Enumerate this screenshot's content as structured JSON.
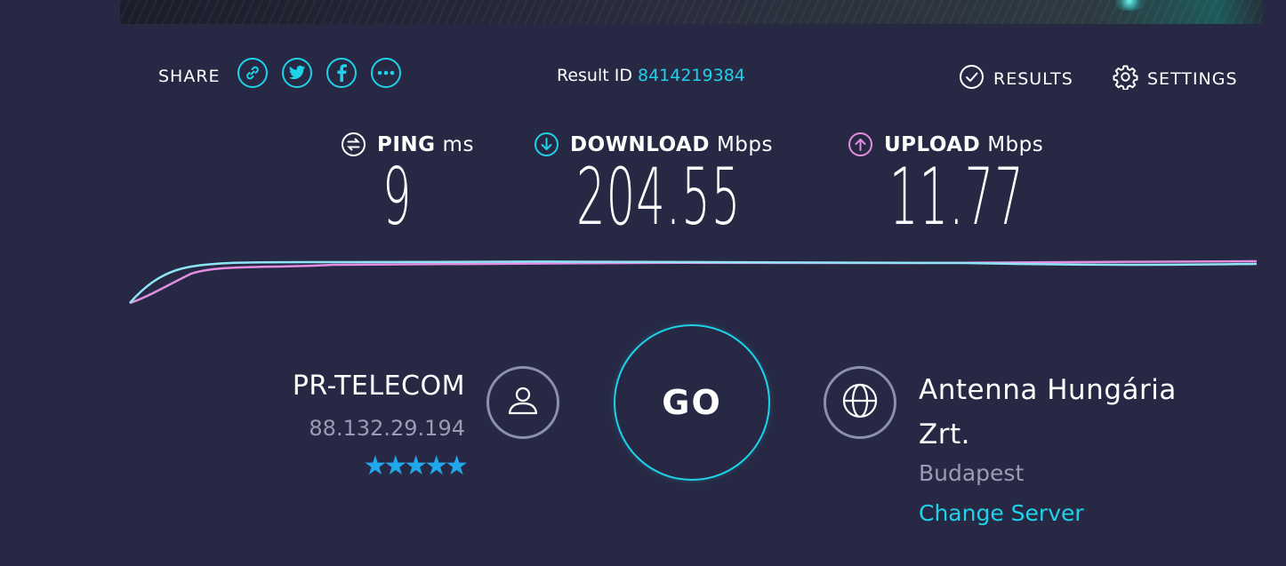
{
  "share": {
    "label": "SHARE"
  },
  "result": {
    "label": "Result ID",
    "id": "8414219384"
  },
  "nav": {
    "results": "RESULTS",
    "settings": "SETTINGS"
  },
  "metrics": {
    "ping": {
      "name": "PING",
      "unit": "ms",
      "value": "9"
    },
    "download": {
      "name": "DOWNLOAD",
      "unit": "Mbps",
      "value": "204.55"
    },
    "upload": {
      "name": "UPLOAD",
      "unit": "Mbps",
      "value": "11.77"
    }
  },
  "isp": {
    "name": "PR-TELECOM",
    "ip": "88.132.29.194",
    "rating": 5,
    "stars": "★★★★★"
  },
  "go": {
    "label": "GO"
  },
  "server": {
    "name": "Antenna Hungária Zrt.",
    "city": "Budapest",
    "change_label": "Change Server"
  },
  "colors": {
    "background": "#272944",
    "accent": "#1fd2ea",
    "upload": "#e38ee0",
    "muted": "#9a9cb6",
    "stars": "#21a8ec"
  }
}
